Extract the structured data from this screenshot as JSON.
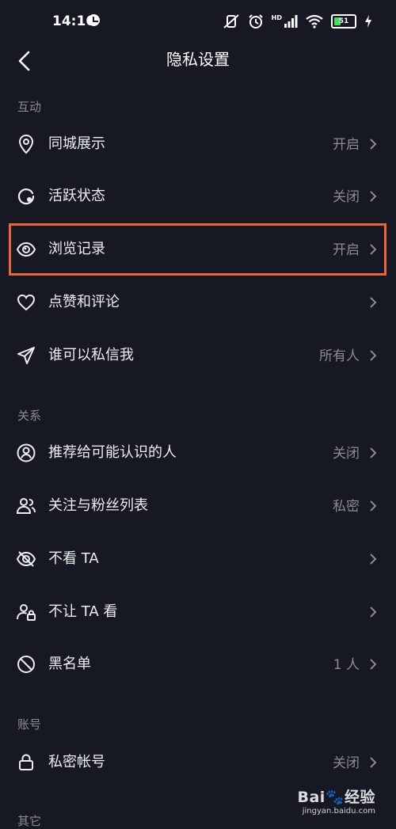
{
  "status_bar": {
    "time": "14:16",
    "battery_level": "51",
    "network_label": "HD",
    "icons": [
      "vibrate-off-icon",
      "alarm-icon",
      "signal-icon",
      "wifi-icon",
      "battery-icon",
      "charging-icon"
    ]
  },
  "header": {
    "title": "隐私设置",
    "back_icon": "chevron-left-icon"
  },
  "sections": {
    "interaction": "互动",
    "relations": "关系",
    "account": "账号",
    "other": "其它"
  },
  "rows": {
    "local_display": {
      "label": "同城展示",
      "value": "开启",
      "icon": "location-pin-icon"
    },
    "active_status": {
      "label": "活跃状态",
      "value": "关闭",
      "icon": "active-status-icon"
    },
    "browse_history": {
      "label": "浏览记录",
      "value": "开启",
      "icon": "eye-icon"
    },
    "likes_comments": {
      "label": "点赞和评论",
      "value": "",
      "icon": "heart-icon"
    },
    "who_can_message": {
      "label": "谁可以私信我",
      "value": "所有人",
      "icon": "send-icon"
    },
    "recommend": {
      "label": "推荐给可能认识的人",
      "value": "关闭",
      "icon": "user-circle-icon"
    },
    "follow_list": {
      "label": "关注与粉丝列表",
      "value": "私密",
      "icon": "users-icon"
    },
    "hide_them": {
      "label": "不看 TA",
      "value": "",
      "icon": "eye-off-icon"
    },
    "hide_from_them": {
      "label": "不让 TA 看",
      "value": "",
      "icon": "user-lock-icon"
    },
    "blacklist": {
      "label": "黑名单",
      "value": "1 人",
      "icon": "block-icon"
    },
    "private_account": {
      "label": "私密帐号",
      "value": "关闭",
      "icon": "lock-icon"
    }
  },
  "colors": {
    "background": "#161823",
    "highlight": "#e6673a",
    "secondary_text": "#8b8c92"
  },
  "watermark": {
    "logo_text": "Bai",
    "logo_suffix": "经验",
    "url": "jingyan.baidu.com"
  }
}
